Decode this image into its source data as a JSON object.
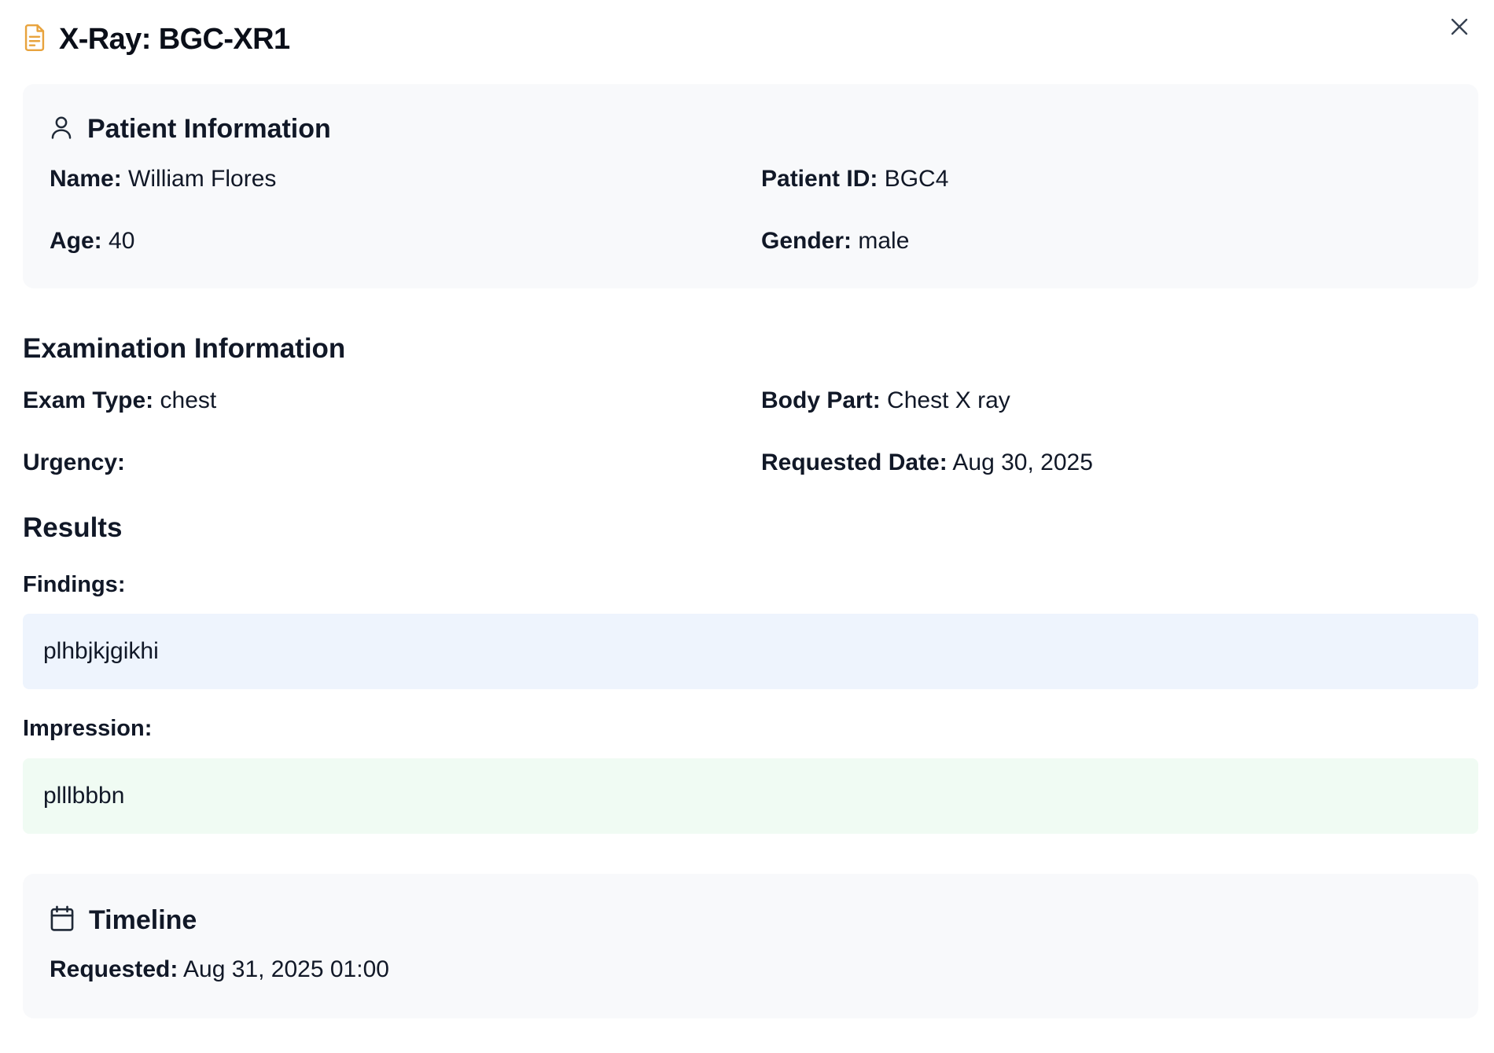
{
  "header": {
    "title": "X-Ray: BGC-XR1",
    "icon": "document-icon",
    "icon_color": "#e8a33d"
  },
  "patient": {
    "heading": "Patient Information",
    "name_label": "Name:",
    "name": "William Flores",
    "id_label": "Patient ID:",
    "id": "BGC4",
    "age_label": "Age:",
    "age": "40",
    "gender_label": "Gender:",
    "gender": "male"
  },
  "exam": {
    "heading": "Examination Information",
    "type_label": "Exam Type:",
    "type": "chest",
    "body_label": "Body Part:",
    "body": "Chest X ray",
    "urgency_label": "Urgency:",
    "urgency": "",
    "date_label": "Requested Date:",
    "date": "Aug 30, 2025"
  },
  "results": {
    "heading": "Results",
    "findings_label": "Findings:",
    "findings": "plhbjkjgikhi",
    "impression_label": "Impression:",
    "impression": "plllbbbn"
  },
  "timeline": {
    "heading": "Timeline",
    "requested_label": "Requested:",
    "requested": "Aug 31, 2025 01:00"
  },
  "colors": {
    "card_bg": "#f8f9fb",
    "findings_bg": "#eef4fd",
    "impression_bg": "#f0fbf3"
  }
}
